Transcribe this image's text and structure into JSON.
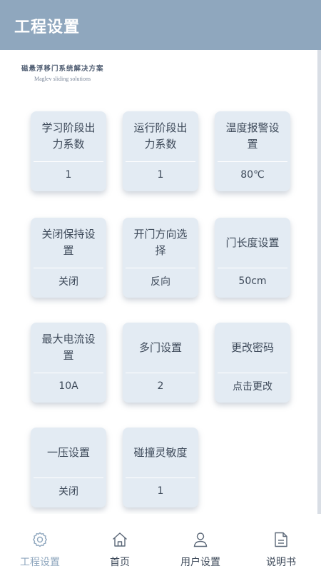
{
  "header": {
    "title": "工程设置"
  },
  "brand": {
    "name_cn": "磁悬浮移门系统解决方案",
    "name_en": "Maglev sliding solutions"
  },
  "settings": [
    {
      "label": "学习阶段出力系数",
      "value": "1"
    },
    {
      "label": "运行阶段出力系数",
      "value": "1"
    },
    {
      "label": "温度报警设置",
      "value": "80℃"
    },
    {
      "label": "关闭保持设置",
      "value": "关闭"
    },
    {
      "label": "开门方向选择",
      "value": "反向"
    },
    {
      "label": "门长度设置",
      "value": "50cm"
    },
    {
      "label": "最大电流设置",
      "value": "10A"
    },
    {
      "label": "多门设置",
      "value": "2"
    },
    {
      "label": "更改密码",
      "value": "点击更改"
    },
    {
      "label": "一压设置",
      "value": "关闭"
    },
    {
      "label": "碰撞灵敏度",
      "value": "1"
    }
  ],
  "bottom_nav": [
    {
      "label": "工程设置",
      "icon": "gear-icon",
      "active": true
    },
    {
      "label": "首页",
      "icon": "home-icon",
      "active": false
    },
    {
      "label": "用户设置",
      "icon": "user-icon",
      "active": false
    },
    {
      "label": "说明书",
      "icon": "document-icon",
      "active": false
    }
  ],
  "colors": {
    "header": "#8fa7be",
    "card": "#e3ebf3",
    "text": "#3e4a5a",
    "active_nav": "#8fa7be"
  }
}
